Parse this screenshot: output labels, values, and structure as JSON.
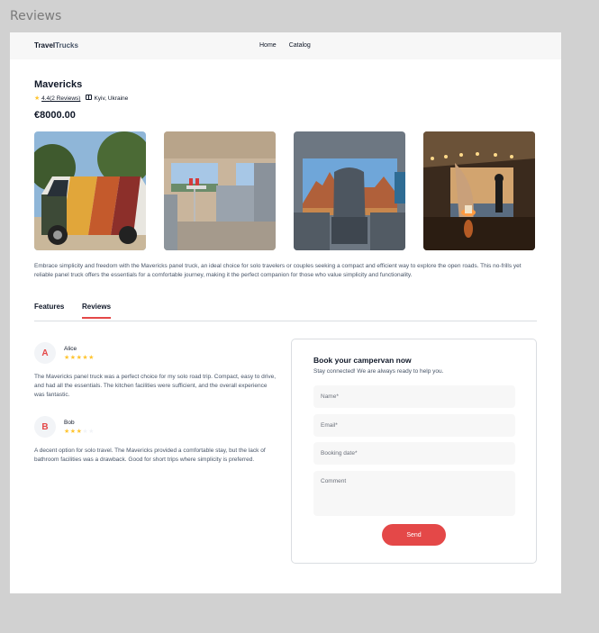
{
  "frame_title": "Reviews",
  "header": {
    "logo_part1": "Travel",
    "logo_part2": "Trucks",
    "nav": [
      "Home",
      "Catalog"
    ]
  },
  "camper": {
    "name": "Mavericks",
    "rating": "4.4",
    "reviews_count": "(2 Reviews)",
    "location": "Kyiv, Ukraine",
    "price": "€8000.00",
    "description": "Embrace simplicity and freedom with the Mavericks panel truck, an ideal choice for solo travelers or couples seeking a compact and efficient way to explore the open roads. This no-frills yet reliable panel truck offers the essentials for a comfortable journey, making it the perfect companion for those who value simplicity and functionality."
  },
  "tabs": [
    "Features",
    "Reviews"
  ],
  "active_tab": "Reviews",
  "reviews": [
    {
      "initial": "A",
      "name": "Alice",
      "rating": 5,
      "text": "The Mavericks panel truck was a perfect choice for my solo road trip. Compact, easy to drive, and had all the essentials. The kitchen facilities were sufficient, and the overall experience was fantastic."
    },
    {
      "initial": "B",
      "name": "Bob",
      "rating": 3,
      "text": "A decent option for solo travel. The Mavericks provided a comfortable stay, but the lack of bathroom facilities was a drawback. Good for short trips where simplicity is preferred."
    }
  ],
  "booking": {
    "title": "Book your campervan now",
    "subtitle": "Stay connected! We are always ready to help you.",
    "name_placeholder": "Name*",
    "email_placeholder": "Email*",
    "date_placeholder": "Booking date*",
    "comment_placeholder": "Comment",
    "send_label": "Send"
  },
  "colors": {
    "accent": "#e44848",
    "star": "#ffc531",
    "text": "#101828",
    "muted": "#475467"
  }
}
